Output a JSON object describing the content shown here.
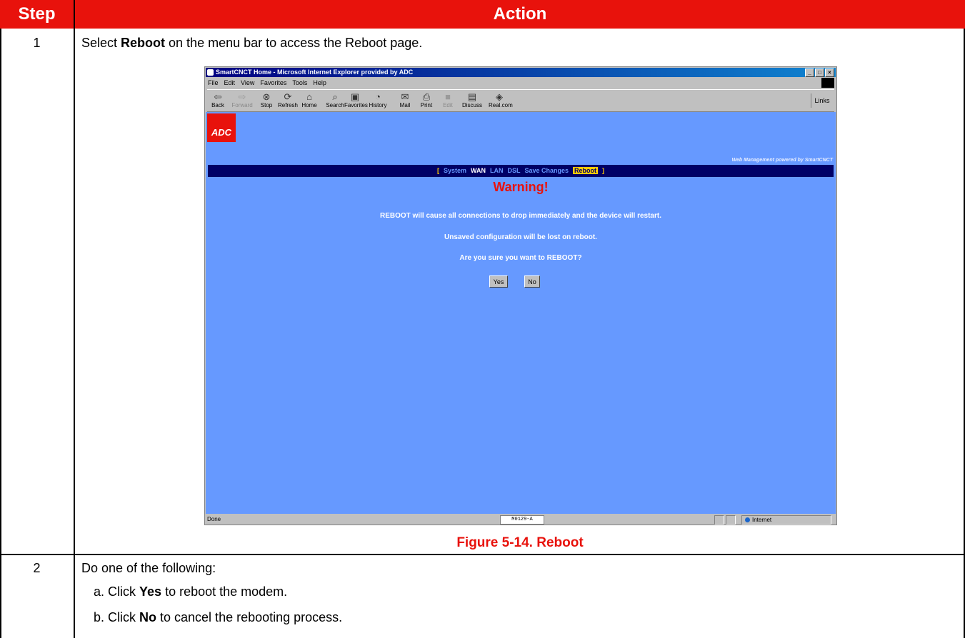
{
  "table": {
    "header_step": "Step",
    "header_action": "Action",
    "rows": [
      {
        "step": "1",
        "text_pre": "Select ",
        "text_bold": "Reboot",
        "text_post": " on the menu bar to access the Reboot page."
      },
      {
        "step": "2",
        "text": "Do one of the following:",
        "items": [
          {
            "pre": "a. Click ",
            "bold": "Yes",
            "post": " to reboot the modem."
          },
          {
            "pre": "b. Click ",
            "bold": "No",
            "post": " to cancel the rebooting process."
          }
        ]
      }
    ],
    "figure_caption": "Figure 5-14. Reboot"
  },
  "screenshot": {
    "window_title": "SmartCNCT Home - Microsoft Internet Explorer provided by ADC",
    "menu": [
      "File",
      "Edit",
      "View",
      "Favorites",
      "Tools",
      "Help"
    ],
    "toolbar": [
      {
        "label": "Back",
        "icon": "back-arrow-icon",
        "glyph": "⇦",
        "enabled": true
      },
      {
        "label": "Forward",
        "icon": "forward-arrow-icon",
        "glyph": "⇨",
        "enabled": false
      },
      {
        "label": "Stop",
        "icon": "stop-icon",
        "glyph": "⊗",
        "enabled": true
      },
      {
        "label": "Refresh",
        "icon": "refresh-icon",
        "glyph": "⟳",
        "enabled": true
      },
      {
        "label": "Home",
        "icon": "home-icon",
        "glyph": "⌂",
        "enabled": true
      },
      {
        "label": "Search",
        "icon": "search-icon",
        "glyph": "⌕",
        "enabled": true
      },
      {
        "label": "Favorites",
        "icon": "favorites-icon",
        "glyph": "▣",
        "enabled": true
      },
      {
        "label": "History",
        "icon": "history-icon",
        "glyph": "◔",
        "enabled": true
      },
      {
        "label": "Mail",
        "icon": "mail-icon",
        "glyph": "✉",
        "enabled": true
      },
      {
        "label": "Print",
        "icon": "print-icon",
        "glyph": "⎙",
        "enabled": true
      },
      {
        "label": "Edit",
        "icon": "edit-icon",
        "glyph": "■",
        "enabled": false
      },
      {
        "label": "Discuss",
        "icon": "discuss-icon",
        "glyph": "▤",
        "enabled": true
      },
      {
        "label": "Real.com",
        "icon": "realcom-icon",
        "glyph": "◈",
        "enabled": true
      }
    ],
    "links_label": "Links",
    "logo_text": "ADC",
    "powered_by": "Web Management powered by SmartCNCT",
    "nav": {
      "open": "[",
      "items": [
        "System",
        "WAN",
        "LAN",
        "DSL",
        "Save Changes",
        "Reboot"
      ],
      "close": "]",
      "current": "WAN",
      "highlighted": "Reboot"
    },
    "warning_title": "Warning!",
    "messages": [
      "REBOOT will cause all connections to drop immediately and the device will restart.",
      "Unsaved configuration will be lost on reboot.",
      "Are you sure you want to REBOOT?"
    ],
    "yes_label": "Yes",
    "no_label": "No",
    "status_done": "Done",
    "status_code": "M0129-A",
    "status_zone": "Internet"
  },
  "colors": {
    "header_red": "#e8120c",
    "page_blue": "#6699ff",
    "nav_navy": "#000066"
  }
}
